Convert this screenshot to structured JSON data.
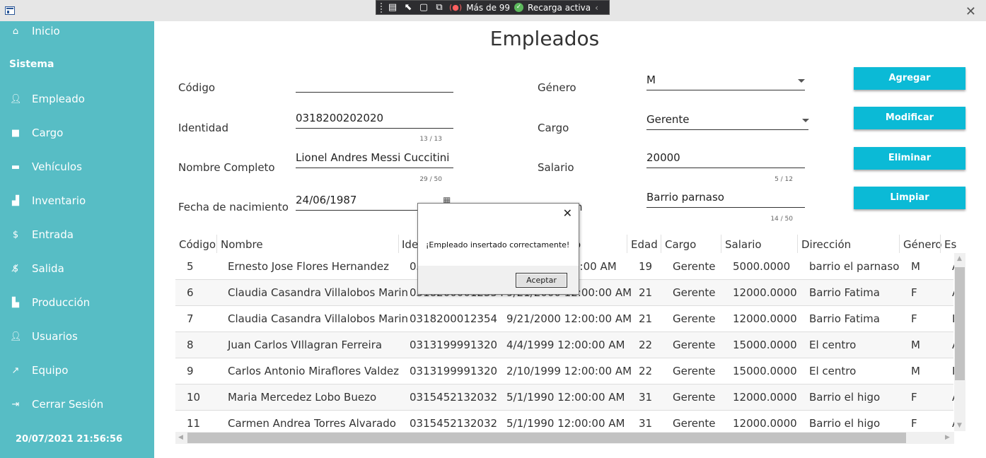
{
  "titlebar": {
    "devtools": {
      "more_label": "Más de 99",
      "reload_label": "Recarga activa"
    }
  },
  "sidebar": {
    "home": "Inicio",
    "section": "Sistema",
    "items": [
      {
        "label": "Empleado",
        "icon": "person-icon"
      },
      {
        "label": "Cargo",
        "icon": "briefcase-icon"
      },
      {
        "label": "Vehículos",
        "icon": "truck-icon"
      },
      {
        "label": "Inventario",
        "icon": "inventory-icon"
      },
      {
        "label": "Entrada",
        "icon": "dollar-icon"
      },
      {
        "label": "Salida",
        "icon": "no-dollar-icon"
      },
      {
        "label": "Producción",
        "icon": "factory-icon"
      },
      {
        "label": "Usuarios",
        "icon": "person-icon"
      },
      {
        "label": "Equipo",
        "icon": "tool-icon"
      },
      {
        "label": "Cerrar Sesión",
        "icon": "logout-icon"
      }
    ],
    "datetime": "20/07/2021 21:56:56"
  },
  "page": {
    "title": "Empleados"
  },
  "form": {
    "codigo": {
      "label": "Código",
      "value": ""
    },
    "identidad": {
      "label": "Identidad",
      "value": "0318200202020",
      "counter": "13 / 13"
    },
    "nombre": {
      "label": "Nombre Completo",
      "value": "Lionel Andres Messi Cuccitini",
      "counter": "29 / 50"
    },
    "fecha": {
      "label": "Fecha de nacimiento",
      "value": "24/06/1987"
    },
    "genero": {
      "label": "Género",
      "value": "M"
    },
    "cargo": {
      "label": "Cargo",
      "value": "Gerente"
    },
    "salario": {
      "label": "Salario",
      "value": "20000",
      "counter": "5 / 12"
    },
    "direccion": {
      "label_partial": "n",
      "value": "Barrio parnaso",
      "counter": "14 / 50"
    }
  },
  "buttons": {
    "agregar": "Agregar",
    "modificar": "Modificar",
    "eliminar": "Eliminar",
    "limpiar": "Limpiar"
  },
  "table": {
    "headers": [
      "Código",
      "Nombre",
      "Ide",
      "o",
      "Edad",
      "Cargo",
      "Salario",
      "Dirección",
      "Género",
      "Es"
    ],
    "rows": [
      [
        "5",
        "Ernesto Jose  Flores Hernandez",
        "03",
        "0:00 AM",
        "19",
        "Gerente",
        "5000.0000",
        "barrio el parnaso",
        "M",
        "A"
      ],
      [
        "6",
        "Claudia Casandra Villalobos Marin",
        "03182000012354",
        "9/21/2000 12:00:00 AM",
        "21",
        "Gerente",
        "12000.0000",
        "Barrio Fatima",
        "F",
        "A"
      ],
      [
        "7",
        "Claudia Casandra Villalobos Marin",
        "0318200012354",
        "9/21/2000 12:00:00 AM",
        "21",
        "Gerente",
        "12000.0000",
        "Barrio Fatima",
        "F",
        "I"
      ],
      [
        "8",
        "Juan Carlos VIllagran Ferreira",
        "0313199991320",
        "4/4/1999 12:00:00 AM",
        "22",
        "Gerente",
        "15000.0000",
        "El centro",
        "M",
        "A"
      ],
      [
        "9",
        "Carlos Antonio Miraflores Valdez",
        "0313199991320",
        "2/10/1999 12:00:00 AM",
        "22",
        "Gerente",
        "15000.0000",
        "El centro",
        "M",
        "I"
      ],
      [
        "10",
        "Maria Mercedez Lobo Buezo",
        "0315452132032",
        "5/1/1990 12:00:00 AM",
        "31",
        "Gerente",
        "12000.0000",
        "Barrio el higo",
        "F",
        "A"
      ],
      [
        "11",
        "Carmen Andrea Torres Alvarado",
        "0315452132032",
        "5/1/1990 12:00:00 AM",
        "31",
        "Gerente",
        "12000.0000",
        "Barrio el higo",
        "F",
        "A"
      ]
    ]
  },
  "dialog": {
    "message": "¡Empleado insertado correctamente!",
    "ok": "Aceptar"
  }
}
